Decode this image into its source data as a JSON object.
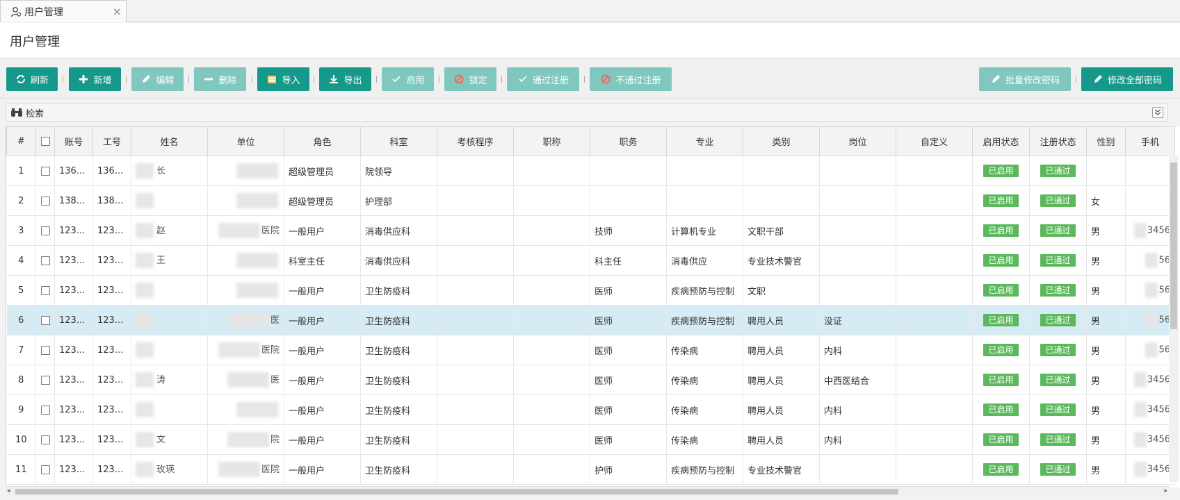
{
  "tab": {
    "label": "用户管理",
    "close": "×"
  },
  "page_title": "用户管理",
  "toolbar": {
    "refresh": "刷新",
    "add": "新增",
    "edit": "编辑",
    "delete": "删除",
    "import": "导入",
    "export": "导出",
    "enable": "启用",
    "lock": "锁定",
    "approve": "通过注册",
    "reject": "不通过注册",
    "batch_pwd": "批量修改密码",
    "all_pwd": "修改全部密码"
  },
  "search": {
    "label": "检索"
  },
  "columns": [
    "#",
    "",
    "账号",
    "工号",
    "姓名",
    "单位",
    "角色",
    "科室",
    "考核程序",
    "职称",
    "职务",
    "专业",
    "类别",
    "岗位",
    "自定义",
    "启用状态",
    "注册状态",
    "性别",
    "手机"
  ],
  "rows": [
    {
      "num": "1",
      "acct": "136...",
      "job": "136...",
      "name": "长",
      "unit": "",
      "role": "超级管理员",
      "dept": "院领导",
      "title": "",
      "post": "",
      "major": "",
      "cat": "",
      "pos": "",
      "custom": "",
      "enable": "已启用",
      "reg": "已通过",
      "sex": "",
      "phone": ""
    },
    {
      "num": "2",
      "acct": "138...",
      "job": "138...",
      "name": "",
      "unit": "",
      "role": "超级管理员",
      "dept": "护理部",
      "title": "",
      "post": "",
      "major": "",
      "cat": "",
      "pos": "",
      "custom": "",
      "enable": "已启用",
      "reg": "已通过",
      "sex": "女",
      "phone": ""
    },
    {
      "num": "3",
      "acct": "123...",
      "job": "123...",
      "name": "赵",
      "unit": "医院",
      "role": "一般用户",
      "dept": "消毒供应科",
      "title": "",
      "post": "技师",
      "major": "计算机专业",
      "cat": "文职干部",
      "pos": "",
      "custom": "",
      "enable": "已启用",
      "reg": "已通过",
      "sex": "男",
      "phone": "3456"
    },
    {
      "num": "4",
      "acct": "123...",
      "job": "123...",
      "name": "王",
      "unit": "",
      "role": "科室主任",
      "dept": "消毒供应科",
      "title": "",
      "post": "科主任",
      "major": "消毒供应",
      "cat": "专业技术警官",
      "pos": "",
      "custom": "",
      "enable": "已启用",
      "reg": "已通过",
      "sex": "男",
      "phone": "56"
    },
    {
      "num": "5",
      "acct": "123...",
      "job": "123...",
      "name": "",
      "unit": "",
      "role": "一般用户",
      "dept": "卫生防疫科",
      "title": "",
      "post": "医师",
      "major": "疾病预防与控制",
      "cat": "文职",
      "pos": "",
      "custom": "",
      "enable": "已启用",
      "reg": "已通过",
      "sex": "男",
      "phone": "56"
    },
    {
      "num": "6",
      "acct": "123...",
      "job": "123...",
      "name": "",
      "unit": "医",
      "role": "一般用户",
      "dept": "卫生防疫科",
      "title": "",
      "post": "医师",
      "major": "疾病预防与控制",
      "cat": "聘用人员",
      "pos": "没证",
      "custom": "",
      "enable": "已启用",
      "reg": "已通过",
      "sex": "男",
      "phone": "56"
    },
    {
      "num": "7",
      "acct": "123...",
      "job": "123...",
      "name": "",
      "unit": "医院",
      "role": "一般用户",
      "dept": "卫生防疫科",
      "title": "",
      "post": "医师",
      "major": "传染病",
      "cat": "聘用人员",
      "pos": "内科",
      "custom": "",
      "enable": "已启用",
      "reg": "已通过",
      "sex": "男",
      "phone": "56"
    },
    {
      "num": "8",
      "acct": "123...",
      "job": "123...",
      "name": "涛",
      "unit": "医",
      "role": "一般用户",
      "dept": "卫生防疫科",
      "title": "",
      "post": "医师",
      "major": "传染病",
      "cat": "聘用人员",
      "pos": "中西医结合",
      "custom": "",
      "enable": "已启用",
      "reg": "已通过",
      "sex": "男",
      "phone": "3456"
    },
    {
      "num": "9",
      "acct": "123...",
      "job": "123...",
      "name": "",
      "unit": "",
      "role": "一般用户",
      "dept": "卫生防疫科",
      "title": "",
      "post": "医师",
      "major": "传染病",
      "cat": "聘用人员",
      "pos": "内科",
      "custom": "",
      "enable": "已启用",
      "reg": "已通过",
      "sex": "男",
      "phone": "3456"
    },
    {
      "num": "10",
      "acct": "123...",
      "job": "123...",
      "name": "文",
      "unit": "院",
      "role": "一般用户",
      "dept": "卫生防疫科",
      "title": "",
      "post": "医师",
      "major": "传染病",
      "cat": "聘用人员",
      "pos": "内科",
      "custom": "",
      "enable": "已启用",
      "reg": "已通过",
      "sex": "男",
      "phone": "3456"
    },
    {
      "num": "11",
      "acct": "123...",
      "job": "123...",
      "name": "玫瑛",
      "unit": "医院",
      "role": "一般用户",
      "dept": "卫生防疫科",
      "title": "",
      "post": "护师",
      "major": "疾病预防与控制",
      "cat": "专业技术警官",
      "pos": "",
      "custom": "",
      "enable": "已启用",
      "reg": "已通过",
      "sex": "男",
      "phone": "3456"
    }
  ],
  "selected_row": "6",
  "colors": {
    "accent": "#16998a",
    "accent_disabled": "#7fc7bf",
    "badge": "#5cb85c",
    "selected_row": "#d6ebf4"
  }
}
